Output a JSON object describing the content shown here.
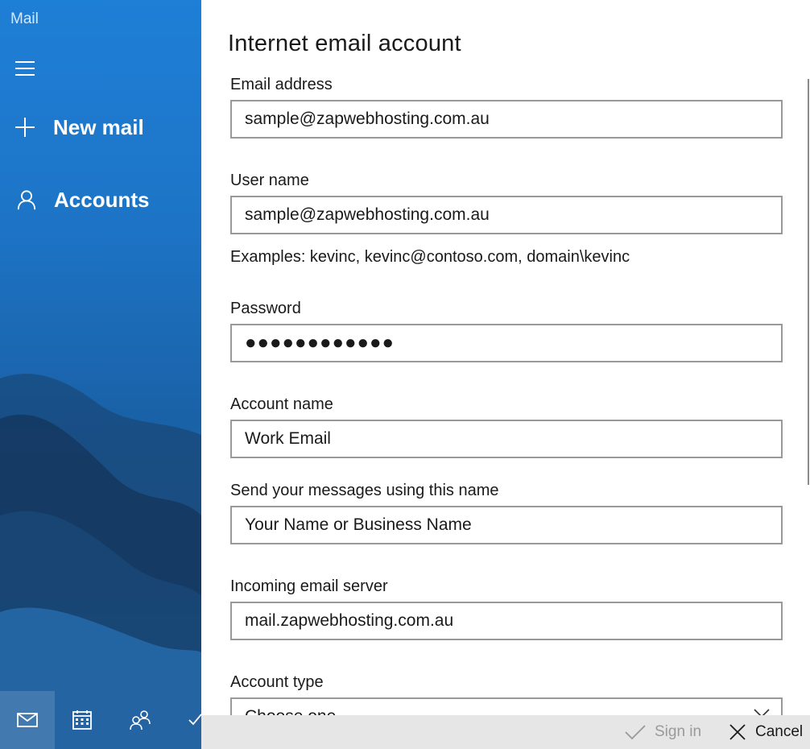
{
  "app": {
    "title": "Mail"
  },
  "sidebar": {
    "new_mail_label": "New mail",
    "accounts_label": "Accounts",
    "bottom_icons": [
      "mail-icon",
      "calendar-icon",
      "people-icon",
      "todo-icon"
    ]
  },
  "form": {
    "title": "Internet email account",
    "email": {
      "label": "Email address",
      "value": "sample@zapwebhosting.com.au"
    },
    "username": {
      "label": "User name",
      "value": "sample@zapwebhosting.com.au",
      "hint": "Examples: kevinc, kevinc@contoso.com, domain\\kevinc"
    },
    "password": {
      "label": "Password",
      "value": "●●●●●●●●●●●●"
    },
    "account_name": {
      "label": "Account name",
      "value": "Work Email"
    },
    "send_name": {
      "label": "Send your messages using this name",
      "value": "Your Name or Business Name"
    },
    "incoming_server": {
      "label": "Incoming email server",
      "value": "mail.zapwebhosting.com.au"
    },
    "account_type": {
      "label": "Account type",
      "value": "Choose one"
    }
  },
  "command_bar": {
    "sign_in_label": "Sign in",
    "cancel_label": "Cancel"
  },
  "colors": {
    "sidebar_accent": "#1e7fd6",
    "input_border": "#999999",
    "command_bar_bg": "#e6e6e6",
    "disabled_text": "#9a9a9a"
  }
}
